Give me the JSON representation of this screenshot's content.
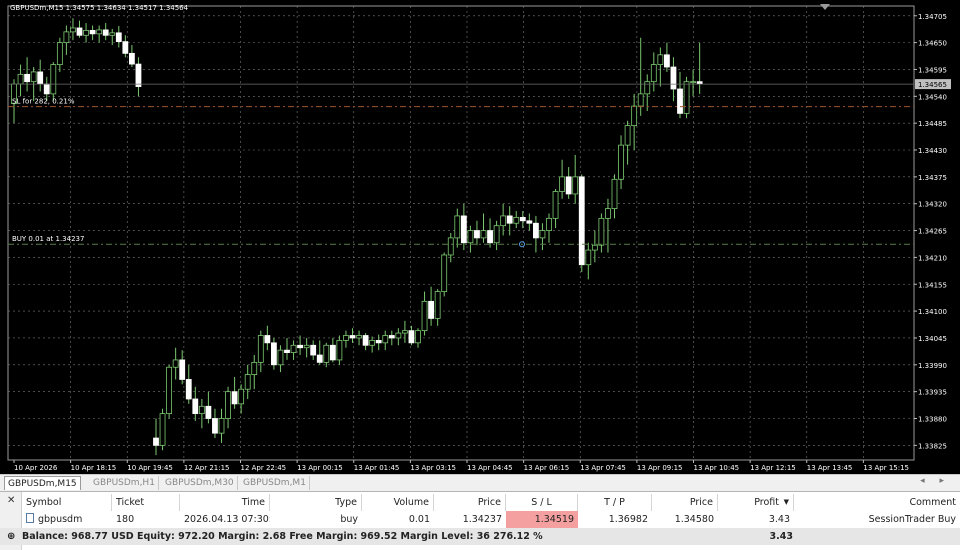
{
  "chart_data": {
    "type": "candlestick",
    "symbol_header": "GBPUSDm,M15  1.34575 1.34634 1.34517 1.34564",
    "y_ticks": [
      "1.34705",
      "1.34650",
      "1.34595",
      "1.34540",
      "1.34485",
      "1.34430",
      "1.34375",
      "1.34320",
      "1.34265",
      "1.34210",
      "1.34155",
      "1.34100",
      "1.34045",
      "1.33990",
      "1.33935",
      "1.33880",
      "1.33825"
    ],
    "x_ticks": [
      "10 Apr 2026",
      "10 Apr 18:15",
      "10 Apr 19:45",
      "12 Apr 21:15",
      "12 Apr 22:45",
      "13 Apr 00:15",
      "13 Apr 01:45",
      "13 Apr 03:15",
      "13 Apr 04:45",
      "13 Apr 06:15",
      "13 Apr 07:45",
      "13 Apr 09:15",
      "13 Apr 10:45",
      "13 Apr 12:15",
      "13 Apr 13:45",
      "13 Apr 15:15"
    ],
    "ylim": [
      1.33795,
      1.34725
    ],
    "current_price": "1.34565",
    "levels": [
      {
        "label": "SL for 282, 0.21%",
        "price": 1.34519,
        "color": "#a0522d"
      },
      {
        "label": "BUY 0.01 at 1.34237",
        "price": 1.34237,
        "color": "#5a7a4a"
      }
    ],
    "candles": [
      [
        1.34525,
        1.34575,
        1.34485,
        1.34565
      ],
      [
        1.34565,
        1.34605,
        1.3454,
        1.34585
      ],
      [
        1.34585,
        1.3462,
        1.3455,
        1.3457
      ],
      [
        1.3457,
        1.346,
        1.3453,
        1.3459
      ],
      [
        1.3459,
        1.34615,
        1.3455,
        1.34565
      ],
      [
        1.34565,
        1.3458,
        1.3453,
        1.34545
      ],
      [
        1.34545,
        1.3461,
        1.3453,
        1.34605
      ],
      [
        1.34605,
        1.3466,
        1.3459,
        1.3465
      ],
      [
        1.3465,
        1.34685,
        1.34625,
        1.34672
      ],
      [
        1.34672,
        1.347,
        1.34655,
        1.3468
      ],
      [
        1.3468,
        1.34695,
        1.3466,
        1.34665
      ],
      [
        1.34665,
        1.3469,
        1.3465,
        1.34675
      ],
      [
        1.34675,
        1.34685,
        1.34655,
        1.34668
      ],
      [
        1.34668,
        1.34685,
        1.3465,
        1.34676
      ],
      [
        1.34676,
        1.3469,
        1.34655,
        1.34665
      ],
      [
        1.34665,
        1.34678,
        1.34645,
        1.3467
      ],
      [
        1.3467,
        1.34684,
        1.3464,
        1.34652
      ],
      [
        1.34652,
        1.34665,
        1.3462,
        1.34628
      ],
      [
        1.34628,
        1.34645,
        1.346,
        1.34606
      ],
      [
        1.34606,
        1.3462,
        1.3454,
        1.3456
      ],
      [
        1.3384,
        1.3388,
        1.33805,
        1.33825
      ],
      [
        1.33825,
        1.339,
        1.33815,
        1.3389
      ],
      [
        1.3389,
        1.3399,
        1.3388,
        1.33985
      ],
      [
        1.33985,
        1.34025,
        1.3396,
        1.34
      ],
      [
        1.34,
        1.3402,
        1.3395,
        1.3396
      ],
      [
        1.3396,
        1.3399,
        1.3391,
        1.3392
      ],
      [
        1.3392,
        1.33945,
        1.33875,
        1.3389
      ],
      [
        1.3389,
        1.3392,
        1.3386,
        1.33905
      ],
      [
        1.33905,
        1.33935,
        1.3387,
        1.3388
      ],
      [
        1.3388,
        1.339,
        1.3384,
        1.3385
      ],
      [
        1.3385,
        1.339,
        1.3383,
        1.3388
      ],
      [
        1.3388,
        1.33945,
        1.3386,
        1.33935
      ],
      [
        1.33935,
        1.33965,
        1.339,
        1.3391
      ],
      [
        1.3391,
        1.3395,
        1.3389,
        1.3394
      ],
      [
        1.3394,
        1.3399,
        1.3392,
        1.3397
      ],
      [
        1.3397,
        1.3401,
        1.3394,
        1.33995
      ],
      [
        1.33995,
        1.3406,
        1.33975,
        1.3405
      ],
      [
        1.3405,
        1.3407,
        1.3402,
        1.34035
      ],
      [
        1.34035,
        1.34045,
        1.3398,
        1.3399
      ],
      [
        1.3399,
        1.3403,
        1.33975,
        1.3402
      ],
      [
        1.3402,
        1.34045,
        1.34,
        1.34015
      ],
      [
        1.34015,
        1.3404,
        1.34,
        1.3403
      ],
      [
        1.3403,
        1.3405,
        1.3401,
        1.34025
      ],
      [
        1.34025,
        1.34045,
        1.34005,
        1.3403
      ],
      [
        1.3403,
        1.3404,
        1.34,
        1.3401
      ],
      [
        1.3401,
        1.3404,
        1.3399,
        1.33995
      ],
      [
        1.33995,
        1.34035,
        1.33985,
        1.3403
      ],
      [
        1.3403,
        1.34045,
        1.33995,
        1.34
      ],
      [
        1.34,
        1.3405,
        1.3399,
        1.3404
      ],
      [
        1.3404,
        1.3406,
        1.34025,
        1.3405
      ],
      [
        1.3405,
        1.34065,
        1.34035,
        1.34045
      ],
      [
        1.34045,
        1.3406,
        1.3403,
        1.3405
      ],
      [
        1.3405,
        1.34055,
        1.3402,
        1.3403
      ],
      [
        1.3403,
        1.34048,
        1.34015,
        1.3404
      ],
      [
        1.3404,
        1.34052,
        1.3402,
        1.34035
      ],
      [
        1.34035,
        1.3406,
        1.3402,
        1.3405
      ],
      [
        1.3405,
        1.3406,
        1.3403,
        1.34045
      ],
      [
        1.34045,
        1.34065,
        1.3403,
        1.34055
      ],
      [
        1.34055,
        1.3408,
        1.34035,
        1.3406
      ],
      [
        1.3406,
        1.3407,
        1.3403,
        1.34035
      ],
      [
        1.34035,
        1.34065,
        1.34025,
        1.3406
      ],
      [
        1.3406,
        1.3414,
        1.3405,
        1.3412
      ],
      [
        1.3412,
        1.3415,
        1.3407,
        1.34085
      ],
      [
        1.34085,
        1.34145,
        1.3407,
        1.3414
      ],
      [
        1.3414,
        1.3422,
        1.3413,
        1.34215
      ],
      [
        1.34215,
        1.3426,
        1.342,
        1.3425
      ],
      [
        1.3425,
        1.3431,
        1.3423,
        1.34295
      ],
      [
        1.34295,
        1.3432,
        1.34225,
        1.3424
      ],
      [
        1.3424,
        1.34275,
        1.3422,
        1.34265
      ],
      [
        1.34265,
        1.34285,
        1.34235,
        1.3425
      ],
      [
        1.3425,
        1.343,
        1.3424,
        1.34265
      ],
      [
        1.34265,
        1.3429,
        1.3423,
        1.3424
      ],
      [
        1.3424,
        1.34285,
        1.34225,
        1.34275
      ],
      [
        1.34275,
        1.3432,
        1.34255,
        1.34295
      ],
      [
        1.34295,
        1.34315,
        1.34255,
        1.3428
      ],
      [
        1.3428,
        1.34305,
        1.3427,
        1.34292
      ],
      [
        1.34292,
        1.34305,
        1.3427,
        1.34285
      ],
      [
        1.34285,
        1.343,
        1.34265,
        1.3428
      ],
      [
        1.3428,
        1.34295,
        1.3422,
        1.3425
      ],
      [
        1.3425,
        1.3428,
        1.34225,
        1.34265
      ],
      [
        1.34265,
        1.343,
        1.3424,
        1.3429
      ],
      [
        1.3429,
        1.3435,
        1.3427,
        1.34345
      ],
      [
        1.34345,
        1.3441,
        1.3433,
        1.34375
      ],
      [
        1.34375,
        1.34395,
        1.3433,
        1.3434
      ],
      [
        1.3434,
        1.3442,
        1.3432,
        1.34375
      ],
      [
        1.34375,
        1.3438,
        1.3418,
        1.34195
      ],
      [
        1.34195,
        1.3424,
        1.34165,
        1.34225
      ],
      [
        1.34225,
        1.34265,
        1.342,
        1.34235
      ],
      [
        1.34235,
        1.343,
        1.3422,
        1.3429
      ],
      [
        1.3429,
        1.3433,
        1.3422,
        1.3431
      ],
      [
        1.3431,
        1.3438,
        1.3429,
        1.3437
      ],
      [
        1.3437,
        1.3446,
        1.3435,
        1.3444
      ],
      [
        1.3444,
        1.3449,
        1.344,
        1.3448
      ],
      [
        1.3448,
        1.34545,
        1.3443,
        1.3452
      ],
      [
        1.3452,
        1.3466,
        1.345,
        1.34545
      ],
      [
        1.34545,
        1.34585,
        1.3451,
        1.3457
      ],
      [
        1.3457,
        1.3463,
        1.3455,
        1.34605
      ],
      [
        1.34605,
        1.3464,
        1.3456,
        1.34625
      ],
      [
        1.34625,
        1.3465,
        1.3459,
        1.346
      ],
      [
        1.346,
        1.3462,
        1.3453,
        1.34555
      ],
      [
        1.34555,
        1.3459,
        1.34495,
        1.34505
      ],
      [
        1.34505,
        1.3458,
        1.34495,
        1.3457
      ],
      [
        1.3457,
        1.34595,
        1.3454,
        1.3457
      ],
      [
        1.3457,
        1.3465,
        1.34545,
        1.34565
      ]
    ],
    "colors": {
      "bull": "#000000",
      "bull_border": "#7bc96f",
      "bear": "#ffffff",
      "grid": "#7a7a7a",
      "axis_text": "#ffffff"
    }
  },
  "tabs": [
    {
      "label": "GBPUSDm,M15",
      "active": true
    },
    {
      "label": "GBPUSDm,H1",
      "active": false
    },
    {
      "label": "GBPUSDm,M30",
      "active": false
    },
    {
      "label": "GBPUSDm,M1",
      "active": false
    }
  ],
  "tab_scroll": "◂ ▸",
  "trade_table": {
    "headers": [
      "Symbol",
      "Ticket",
      "Time",
      "Type",
      "Volume",
      "Price",
      "S / L",
      "T / P",
      "Price",
      "Profit",
      "Comment"
    ],
    "sort_marker": "▼",
    "row": {
      "symbol": "gbpusdm",
      "ticket": "180",
      "time": "2026.04.13 07:30:...",
      "type": "buy",
      "volume": "0.01",
      "price": "1.34237",
      "sl": "1.34519",
      "tp": "1.36982",
      "current_price": "1.34580",
      "profit": "3.43",
      "comment": "SessionTrader Buy"
    },
    "balance_line": "Balance: 968.77 USD  Equity: 972.20  Margin: 2.68  Free Margin: 969.52  Margin Level: 36 276.12 %",
    "total_profit": "3.43"
  },
  "close_glyph": "✕",
  "balance_glyph": "⊕"
}
